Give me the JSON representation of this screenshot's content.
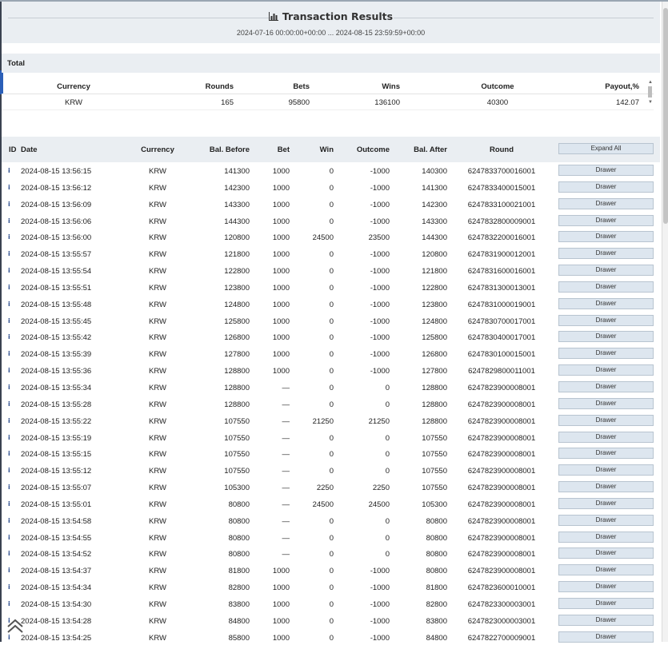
{
  "header": {
    "title": "Transaction Results",
    "date_range": "2024-07-16 00:00:00+00:00 ... 2024-08-15 23:59:59+00:00"
  },
  "total": {
    "label": "Total",
    "columns": [
      "Currency",
      "Rounds",
      "Bets",
      "Wins",
      "Outcome",
      "Payout,%"
    ],
    "row": [
      "KRW",
      "165",
      "95800",
      "136100",
      "40300",
      "142.07"
    ]
  },
  "transactions": {
    "columns": {
      "id": "ID",
      "date": "Date",
      "currency": "Currency",
      "bal_before": "Bal. Before",
      "bet": "Bet",
      "win": "Win",
      "outcome": "Outcome",
      "bal_after": "Bal. After",
      "round": "Round"
    },
    "expand_label": "Expand All",
    "drawer_label": "Drawer",
    "rows": [
      [
        "2024-08-15 13:56:15",
        "KRW",
        "141300",
        "1000",
        "0",
        "-1000",
        "140300",
        "6247833700016001"
      ],
      [
        "2024-08-15 13:56:12",
        "KRW",
        "142300",
        "1000",
        "0",
        "-1000",
        "141300",
        "6247833400015001"
      ],
      [
        "2024-08-15 13:56:09",
        "KRW",
        "143300",
        "1000",
        "0",
        "-1000",
        "142300",
        "6247833100021001"
      ],
      [
        "2024-08-15 13:56:06",
        "KRW",
        "144300",
        "1000",
        "0",
        "-1000",
        "143300",
        "6247832800009001"
      ],
      [
        "2024-08-15 13:56:00",
        "KRW",
        "120800",
        "1000",
        "24500",
        "23500",
        "144300",
        "6247832200016001"
      ],
      [
        "2024-08-15 13:55:57",
        "KRW",
        "121800",
        "1000",
        "0",
        "-1000",
        "120800",
        "6247831900012001"
      ],
      [
        "2024-08-15 13:55:54",
        "KRW",
        "122800",
        "1000",
        "0",
        "-1000",
        "121800",
        "6247831600016001"
      ],
      [
        "2024-08-15 13:55:51",
        "KRW",
        "123800",
        "1000",
        "0",
        "-1000",
        "122800",
        "6247831300013001"
      ],
      [
        "2024-08-15 13:55:48",
        "KRW",
        "124800",
        "1000",
        "0",
        "-1000",
        "123800",
        "6247831000019001"
      ],
      [
        "2024-08-15 13:55:45",
        "KRW",
        "125800",
        "1000",
        "0",
        "-1000",
        "124800",
        "6247830700017001"
      ],
      [
        "2024-08-15 13:55:42",
        "KRW",
        "126800",
        "1000",
        "0",
        "-1000",
        "125800",
        "6247830400017001"
      ],
      [
        "2024-08-15 13:55:39",
        "KRW",
        "127800",
        "1000",
        "0",
        "-1000",
        "126800",
        "6247830100015001"
      ],
      [
        "2024-08-15 13:55:36",
        "KRW",
        "128800",
        "1000",
        "0",
        "-1000",
        "127800",
        "6247829800011001"
      ],
      [
        "2024-08-15 13:55:34",
        "KRW",
        "128800",
        "—",
        "0",
        "0",
        "128800",
        "6247823900008001"
      ],
      [
        "2024-08-15 13:55:28",
        "KRW",
        "128800",
        "—",
        "0",
        "0",
        "128800",
        "6247823900008001"
      ],
      [
        "2024-08-15 13:55:22",
        "KRW",
        "107550",
        "—",
        "21250",
        "21250",
        "128800",
        "6247823900008001"
      ],
      [
        "2024-08-15 13:55:19",
        "KRW",
        "107550",
        "—",
        "0",
        "0",
        "107550",
        "6247823900008001"
      ],
      [
        "2024-08-15 13:55:15",
        "KRW",
        "107550",
        "—",
        "0",
        "0",
        "107550",
        "6247823900008001"
      ],
      [
        "2024-08-15 13:55:12",
        "KRW",
        "107550",
        "—",
        "0",
        "0",
        "107550",
        "6247823900008001"
      ],
      [
        "2024-08-15 13:55:07",
        "KRW",
        "105300",
        "—",
        "2250",
        "2250",
        "107550",
        "6247823900008001"
      ],
      [
        "2024-08-15 13:55:01",
        "KRW",
        "80800",
        "—",
        "24500",
        "24500",
        "105300",
        "6247823900008001"
      ],
      [
        "2024-08-15 13:54:58",
        "KRW",
        "80800",
        "—",
        "0",
        "0",
        "80800",
        "6247823900008001"
      ],
      [
        "2024-08-15 13:54:55",
        "KRW",
        "80800",
        "—",
        "0",
        "0",
        "80800",
        "6247823900008001"
      ],
      [
        "2024-08-15 13:54:52",
        "KRW",
        "80800",
        "—",
        "0",
        "0",
        "80800",
        "6247823900008001"
      ],
      [
        "2024-08-15 13:54:37",
        "KRW",
        "81800",
        "1000",
        "0",
        "-1000",
        "80800",
        "6247823900008001"
      ],
      [
        "2024-08-15 13:54:34",
        "KRW",
        "82800",
        "1000",
        "0",
        "-1000",
        "81800",
        "6247823600010001"
      ],
      [
        "2024-08-15 13:54:30",
        "KRW",
        "83800",
        "1000",
        "0",
        "-1000",
        "82800",
        "6247823300003001"
      ],
      [
        "2024-08-15 13:54:28",
        "KRW",
        "84800",
        "1000",
        "0",
        "-1000",
        "83800",
        "6247823000003001"
      ],
      [
        "2024-08-15 13:54:25",
        "KRW",
        "85800",
        "1000",
        "0",
        "-1000",
        "84800",
        "6247822700009001"
      ]
    ]
  },
  "icons": {
    "title_icon": "bar-chart-icon",
    "row_icon": "info-icon",
    "back_icon": "double-chevron-up-icon"
  },
  "colors": {
    "header_bg": "#eaeef2",
    "button_bg": "#dde6ef",
    "button_border": "#b8c4d0",
    "info_icon": "#2f4f8f"
  }
}
